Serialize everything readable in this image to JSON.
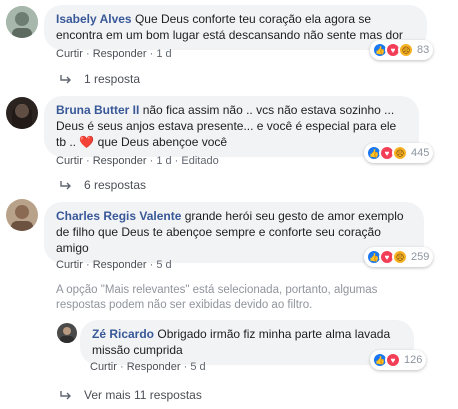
{
  "comments": [
    {
      "author": "Isabely Alves",
      "text": "Que Deus conforte teu coração ela agora se encontra em um bom lugar está descansando não sente mas dor",
      "like": "Curtir",
      "reply": "Responder",
      "time": "1 d",
      "reaction_count": "83",
      "replies_label": "1 resposta"
    },
    {
      "author": "Bruna Butter II",
      "text_a": "não fica assim não .. vcs não estava sozinho ... Deus é seus anjos estava presente... e você é especial para ele tb ..",
      "heart": "❤️",
      "text_b": "que Deus abençoe você",
      "like": "Curtir",
      "reply": "Responder",
      "time": "1 d",
      "edited": "Editado",
      "reaction_count": "445",
      "replies_label": "6 respostas"
    },
    {
      "author": "Charles Regis Valente",
      "text": "grande herói seu gesto de amor exemplo de filho que Deus te abençoe sempre e conforte seu coração amigo",
      "like": "Curtir",
      "reply": "Responder",
      "time": "5 d",
      "reaction_count": "259"
    }
  ],
  "notice": "A opção \"Mais relevantes\" está selecionada, portanto, algumas respostas podem não ser exibidas devido ao filtro.",
  "reply": {
    "author": "Zé Ricardo",
    "text": "Obrigado irmão fiz minha parte alma lavada missão cumprida",
    "like": "Curtir",
    "reply": "Responder",
    "time": "5 d",
    "reaction_count": "126"
  },
  "more_replies": "Ver mais 11 respostas",
  "sep": "·",
  "colors": {
    "link": "#385898",
    "bubble": "#f2f3f5",
    "like": "#1877f2",
    "love": "#f33e58",
    "sad": "#f7b125"
  }
}
